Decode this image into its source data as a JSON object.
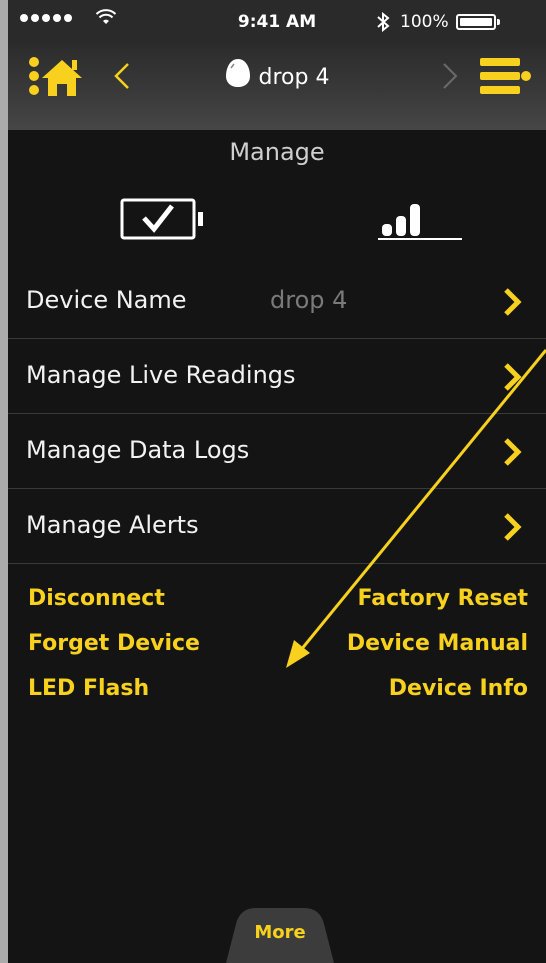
{
  "status_bar": {
    "time": "9:41 AM",
    "battery_percent": "100%",
    "signal_bars": 5,
    "icons": [
      "signal-dots-icon",
      "wifi-icon",
      "bluetooth-icon",
      "battery-icon"
    ]
  },
  "nav": {
    "device_name": "drop 4",
    "icons": [
      "home-icon",
      "back-chevron-icon",
      "drop-device-icon",
      "forward-chevron-icon",
      "menu-icon"
    ]
  },
  "section_title": "Manage",
  "list": {
    "items": [
      {
        "label": "Device Name",
        "value": "drop 4"
      },
      {
        "label": "Manage Live Readings"
      },
      {
        "label": "Manage Data Logs"
      },
      {
        "label": "Manage Alerts"
      }
    ]
  },
  "actions": {
    "left": [
      "Disconnect",
      "Forget Device",
      "LED Flash"
    ],
    "right": [
      "Factory Reset",
      "Device Manual",
      "Device Info"
    ]
  },
  "bottom_tab": {
    "label": "More"
  },
  "colors": {
    "accent": "#f7d11e",
    "background": "#141414",
    "text": "#f2f2f2",
    "muted": "#7a7a7a",
    "annotation_arrow": "#f7d11e"
  }
}
